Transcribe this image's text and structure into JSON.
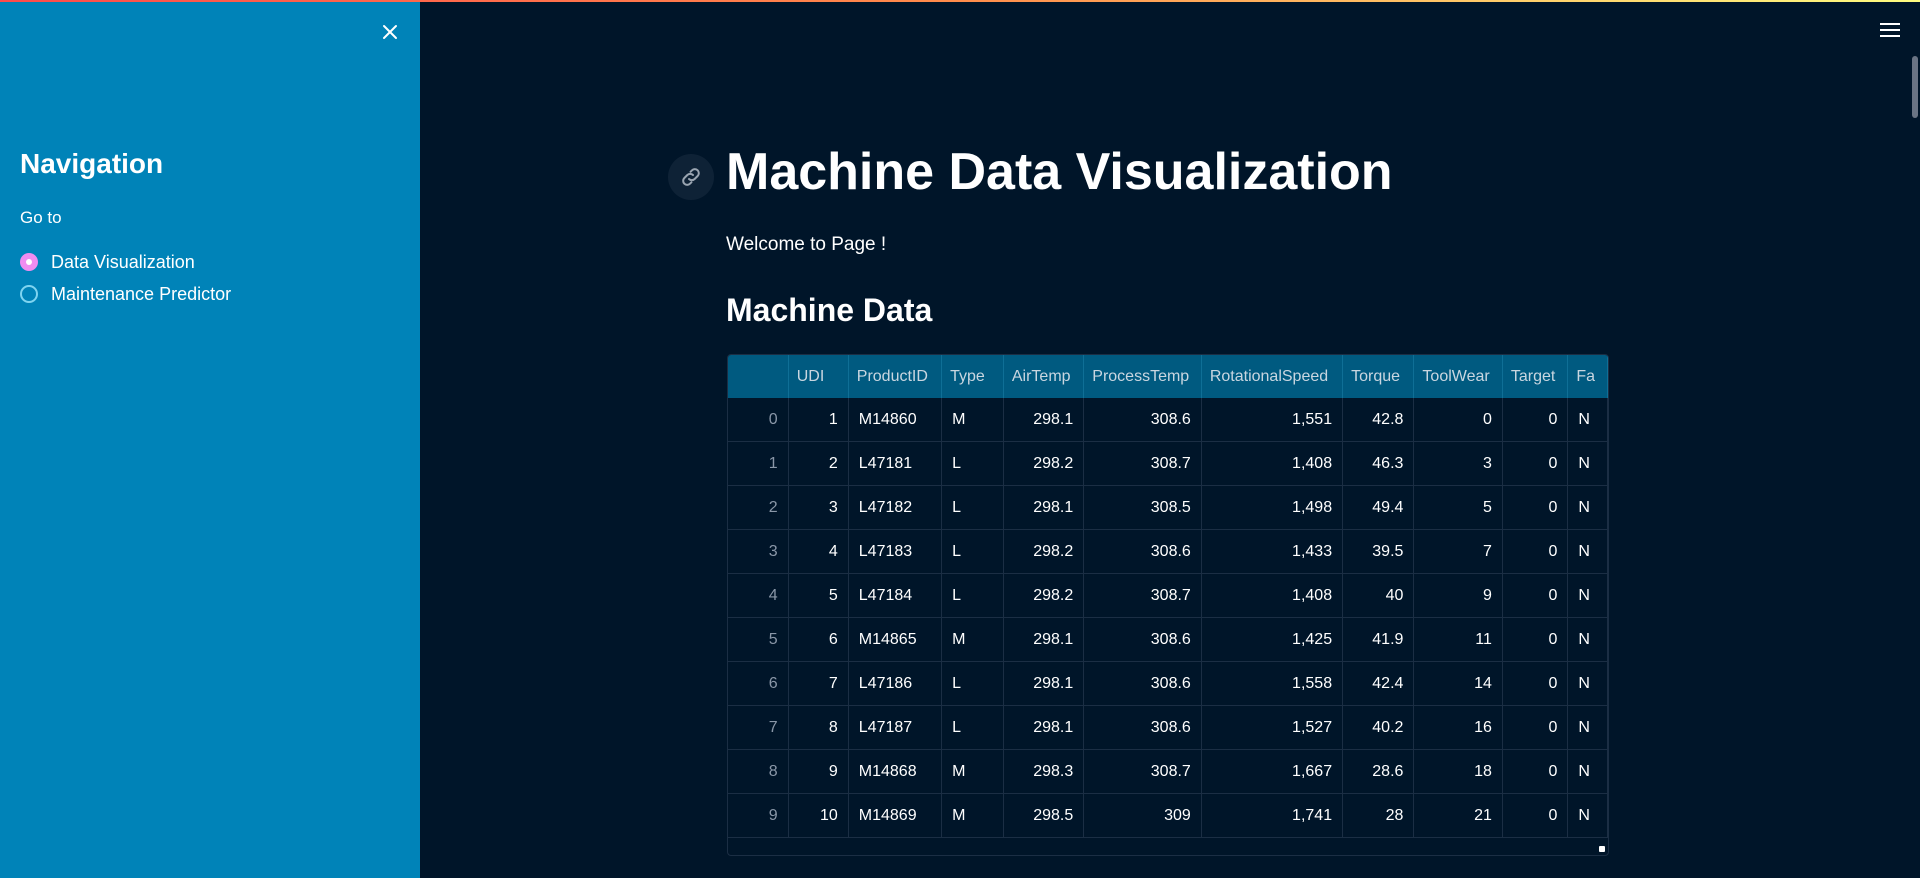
{
  "sidebar": {
    "title": "Navigation",
    "goto_label": "Go to",
    "options": [
      {
        "label": "Data Visualization",
        "selected": true
      },
      {
        "label": "Maintenance Predictor",
        "selected": false
      }
    ],
    "close_icon": "close-icon"
  },
  "header": {
    "menu_icon": "hamburger-menu-icon"
  },
  "main": {
    "anchor_icon": "link-icon",
    "title": "Machine Data Visualization",
    "welcome": "Welcome to Page !",
    "section_title": "Machine Data"
  },
  "table": {
    "columns": [
      "",
      "UDI",
      "ProductID",
      "Type",
      "AirTemp",
      "ProcessTemp",
      "RotationalSpeed",
      "Torque",
      "ToolWear",
      "Target",
      "Fa"
    ],
    "rows": [
      [
        "0",
        "1",
        "M14860",
        "M",
        "298.1",
        "308.6",
        "1,551",
        "42.8",
        "0",
        "0",
        "N"
      ],
      [
        "1",
        "2",
        "L47181",
        "L",
        "298.2",
        "308.7",
        "1,408",
        "46.3",
        "3",
        "0",
        "N"
      ],
      [
        "2",
        "3",
        "L47182",
        "L",
        "298.1",
        "308.5",
        "1,498",
        "49.4",
        "5",
        "0",
        "N"
      ],
      [
        "3",
        "4",
        "L47183",
        "L",
        "298.2",
        "308.6",
        "1,433",
        "39.5",
        "7",
        "0",
        "N"
      ],
      [
        "4",
        "5",
        "L47184",
        "L",
        "298.2",
        "308.7",
        "1,408",
        "40",
        "9",
        "0",
        "N"
      ],
      [
        "5",
        "6",
        "M14865",
        "M",
        "298.1",
        "308.6",
        "1,425",
        "41.9",
        "11",
        "0",
        "N"
      ],
      [
        "6",
        "7",
        "L47186",
        "L",
        "298.1",
        "308.6",
        "1,558",
        "42.4",
        "14",
        "0",
        "N"
      ],
      [
        "7",
        "8",
        "L47187",
        "L",
        "298.1",
        "308.6",
        "1,527",
        "40.2",
        "16",
        "0",
        "N"
      ],
      [
        "8",
        "9",
        "M14868",
        "M",
        "298.3",
        "308.7",
        "1,667",
        "28.6",
        "18",
        "0",
        "N"
      ],
      [
        "9",
        "10",
        "M14869",
        "M",
        "298.5",
        "309",
        "1,741",
        "28",
        "21",
        "0",
        "N"
      ]
    ]
  },
  "colors": {
    "sidebar_bg": "#0083b8",
    "main_bg": "#001529",
    "radio_selected": "#f08cf0",
    "table_header_bg": "#005a80"
  }
}
